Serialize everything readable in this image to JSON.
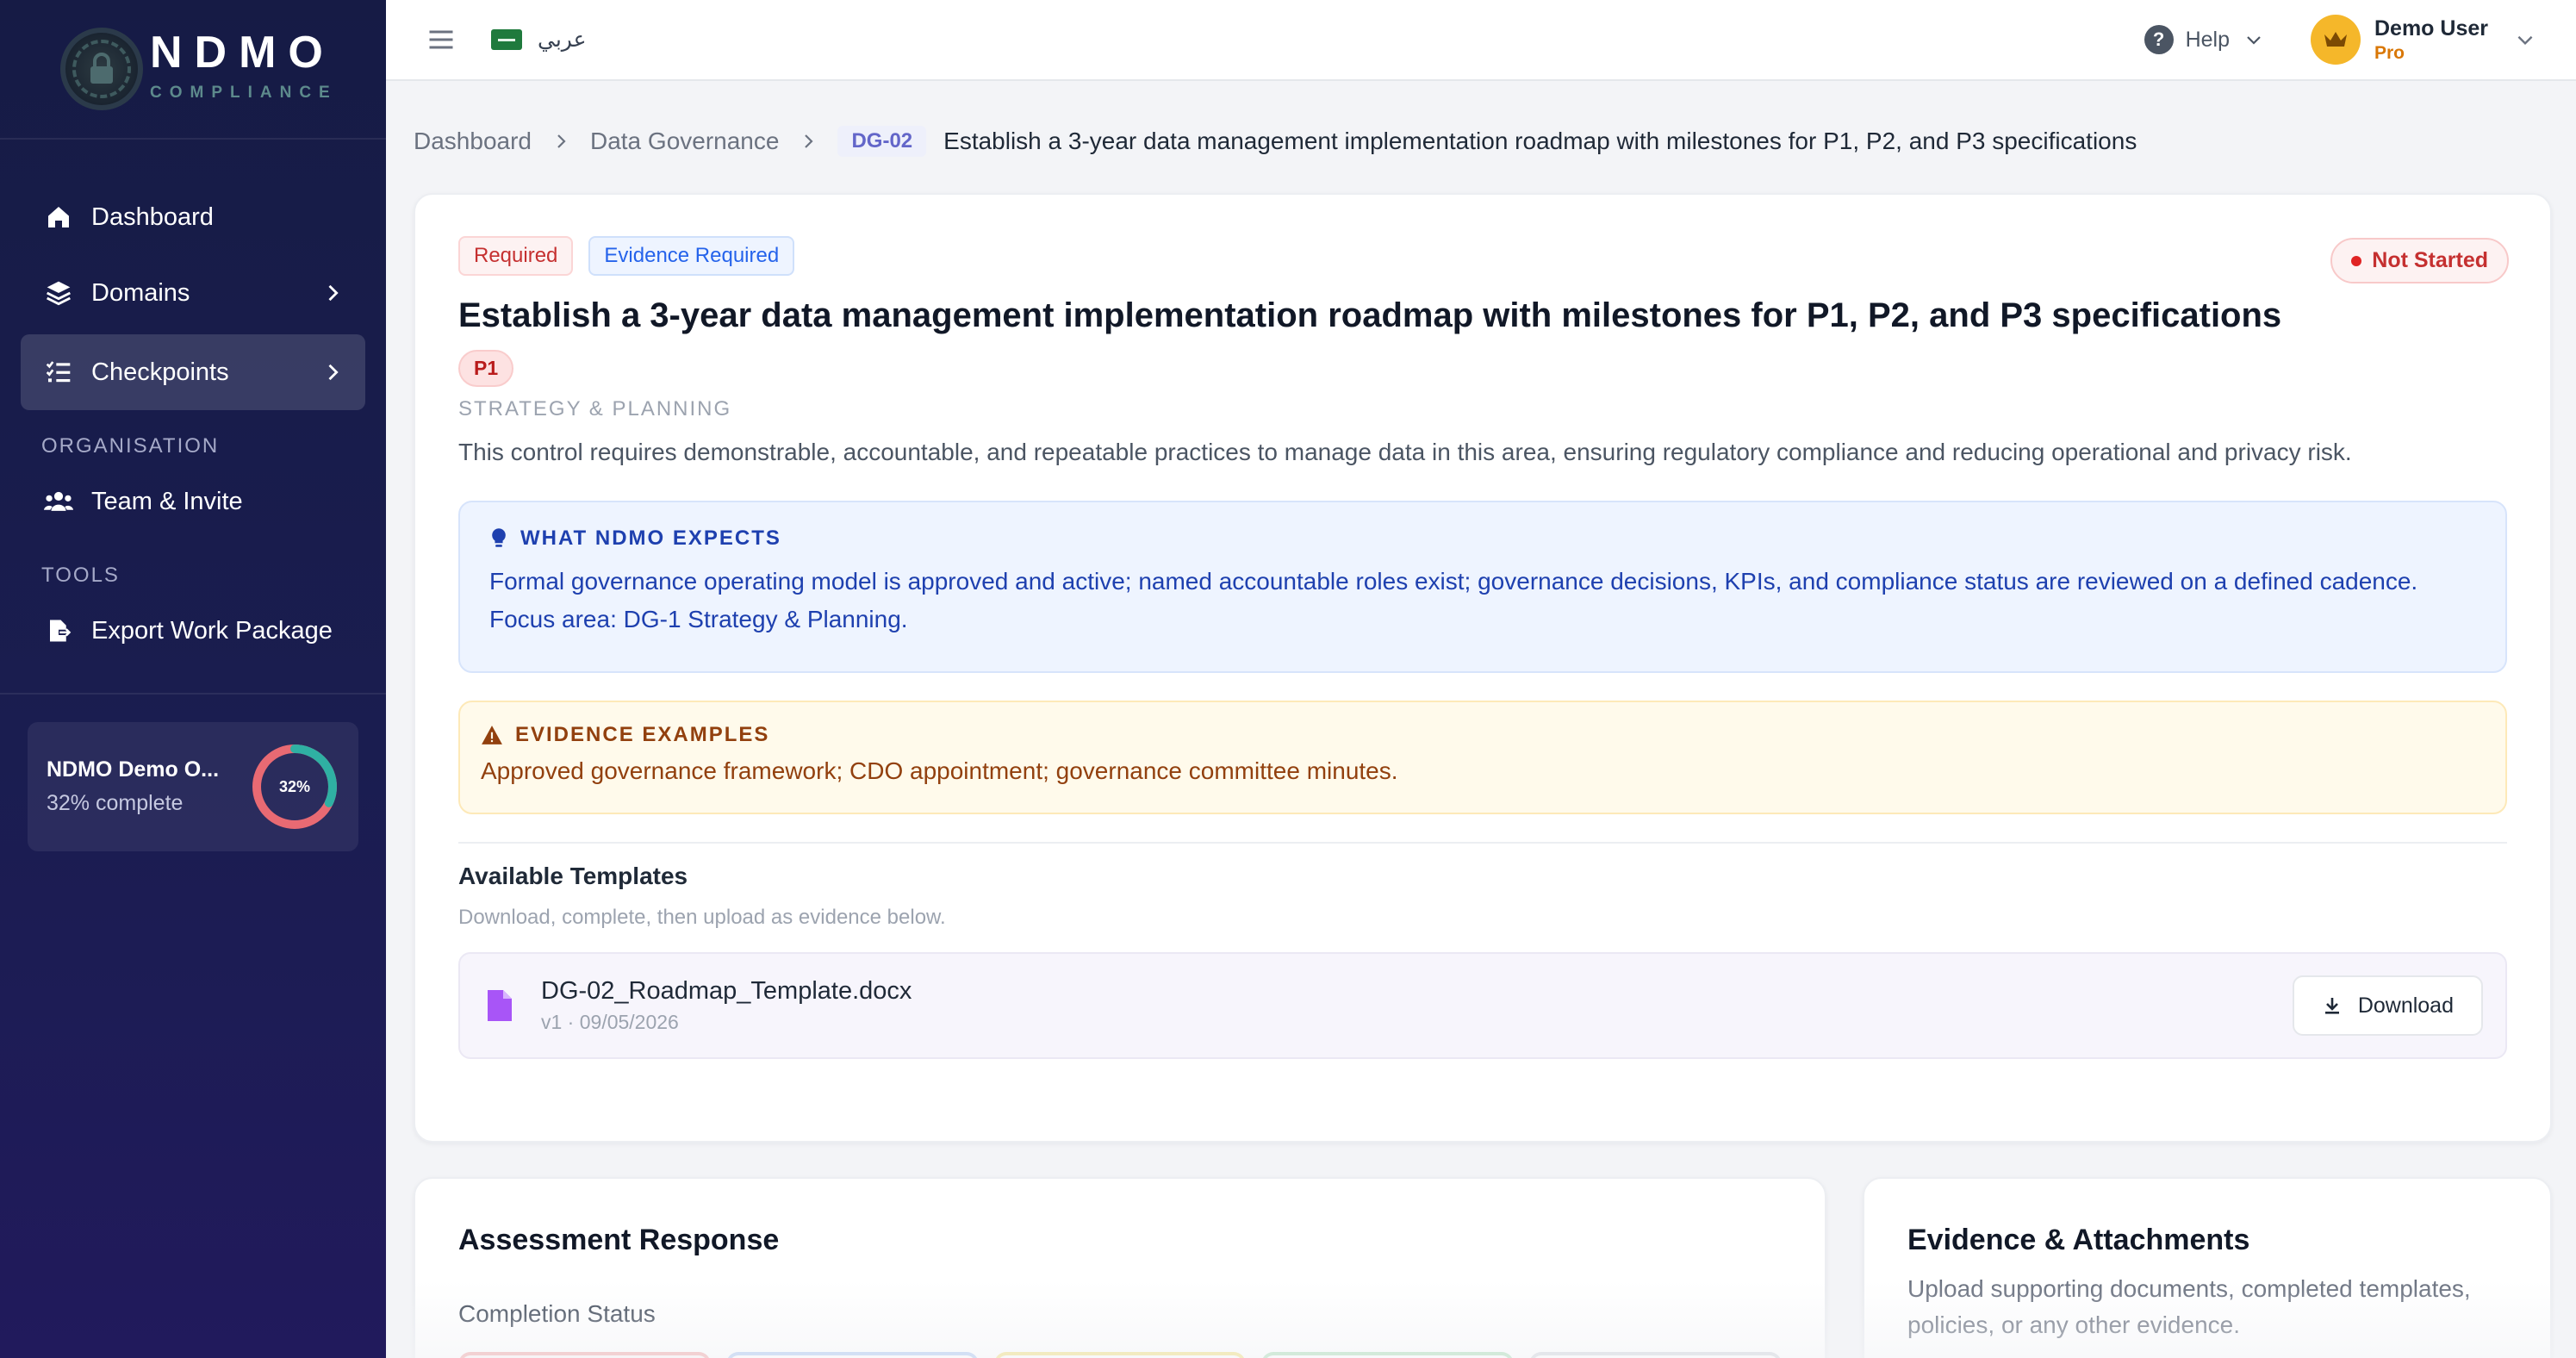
{
  "brand": {
    "name": "NDMO",
    "subtitle": "COMPLIANCE"
  },
  "sidebar": {
    "items": [
      {
        "label": "Dashboard",
        "icon": "home-icon"
      },
      {
        "label": "Domains",
        "icon": "layers-icon"
      },
      {
        "label": "Checkpoints",
        "icon": "checklist-icon",
        "active": true
      }
    ],
    "section_org": "ORGANISATION",
    "org_items": [
      {
        "label": "Team & Invite",
        "icon": "users-icon"
      }
    ],
    "section_tools": "TOOLS",
    "tool_items": [
      {
        "label": "Export Work Package",
        "icon": "file-export-icon"
      }
    ],
    "org_card": {
      "name": "NDMO Demo O...",
      "progress_text": "32% complete",
      "progress_percent": 32,
      "donut_label": "32%"
    }
  },
  "topbar": {
    "language": "عربي",
    "help": "Help",
    "user": {
      "name": "Demo User",
      "plan": "Pro"
    }
  },
  "breadcrumb": {
    "items": [
      "Dashboard",
      "Data Governance"
    ],
    "code": "DG-02",
    "current": "Establish a 3-year data management implementation roadmap with milestones for P1, P2, and P3 specifications"
  },
  "control": {
    "badges": {
      "required": "Required",
      "evidence": "Evidence Required"
    },
    "status": "Not Started",
    "title": "Establish a 3-year data management implementation roadmap with milestones for P1, P2, and P3 specifications",
    "priority": "P1",
    "category": "STRATEGY & PLANNING",
    "description": "This control requires demonstrable, accountable, and repeatable practices to manage data in this area, ensuring regulatory compliance and reducing operational and privacy risk.",
    "expects": {
      "heading": "WHAT NDMO EXPECTS",
      "body": "Formal governance operating model is approved and active; named accountable roles exist; governance decisions, KPIs, and compliance status are reviewed on a defined cadence. Focus area: DG-1 Strategy & Planning."
    },
    "examples": {
      "heading": "EVIDENCE EXAMPLES",
      "body": "Approved governance framework; CDO appointment; governance committee minutes."
    }
  },
  "templates": {
    "title": "Available Templates",
    "subtitle": "Download, complete, then upload as evidence below.",
    "files": [
      {
        "name": "DG-02_Roadmap_Template.docx",
        "meta": "v1 · 09/05/2026",
        "button": "Download"
      }
    ]
  },
  "assessment": {
    "title": "Assessment Response",
    "field_label": "Completion Status",
    "option_colors": [
      "#f0a3a3",
      "#a9c4f0",
      "#f2df7a",
      "#a9dcb4",
      "#d1d5db"
    ]
  },
  "evidence": {
    "title": "Evidence & Attachments",
    "subtitle": "Upload supporting documents, completed templates, policies, or any other evidence."
  },
  "colors": {
    "sidebar": "#161b45",
    "accent": "#6366c9",
    "danger": "#c53030",
    "info": "#1e40af",
    "warning": "#92400e"
  }
}
